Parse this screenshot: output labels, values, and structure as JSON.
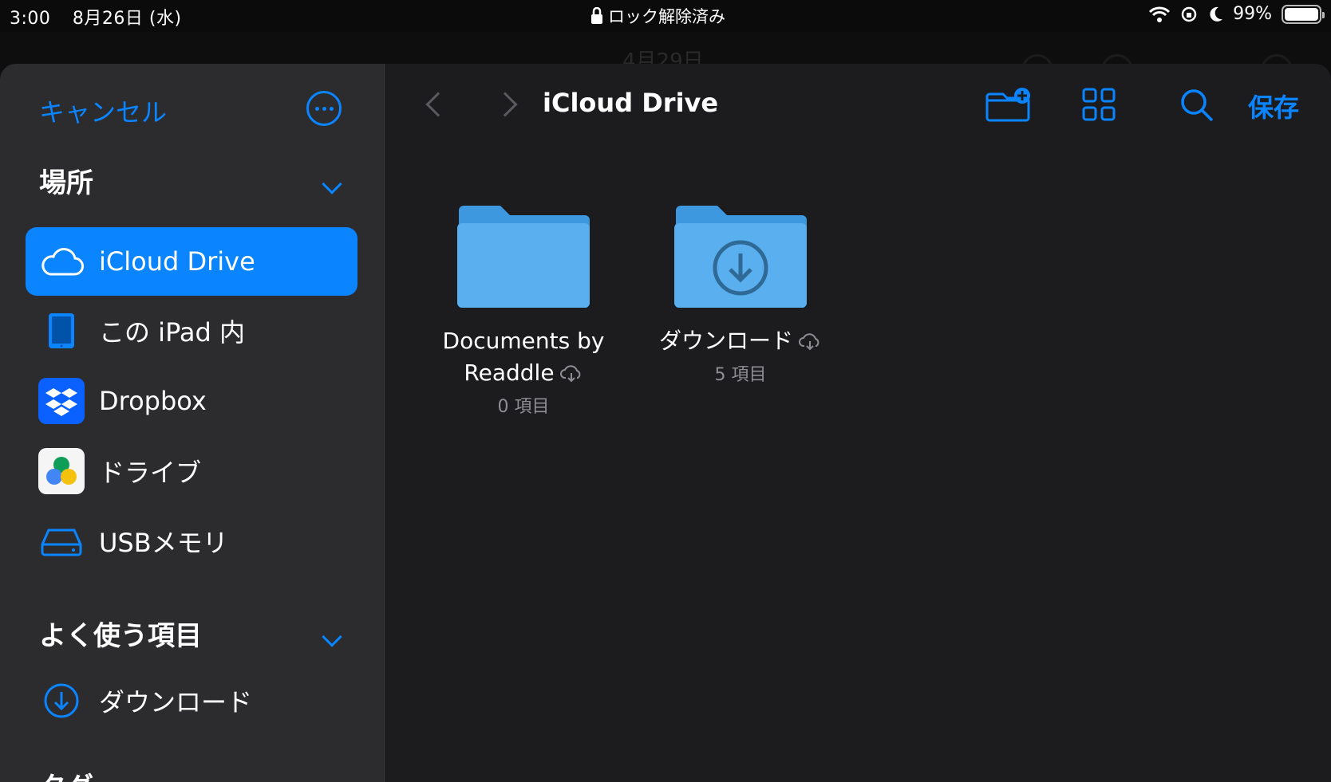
{
  "status": {
    "time": "3:00",
    "date": "8月26日 (水)",
    "lock_text": "ロック解除済み",
    "battery": "99%"
  },
  "background_app": {
    "title": "4月29日"
  },
  "sidebar": {
    "cancel_label": "キャンセル",
    "locations_title": "場所",
    "locations": [
      {
        "label": "iCloud Drive",
        "icon": "cloud-icon",
        "active": true
      },
      {
        "label": "この iPad 内",
        "icon": "ipad-icon",
        "active": false
      },
      {
        "label": "Dropbox",
        "icon": "dropbox-icon",
        "active": false
      },
      {
        "label": "ドライブ",
        "icon": "google-drive-icon",
        "active": false
      },
      {
        "label": "USBメモリ",
        "icon": "usb-drive-icon",
        "active": false
      }
    ],
    "favorites_title": "よく使う項目",
    "favorites": [
      {
        "label": "ダウンロード",
        "icon": "download-circle-icon"
      }
    ],
    "tags_title": "タグ"
  },
  "toolbar": {
    "title": "iCloud Drive",
    "save_label": "保存"
  },
  "folders": [
    {
      "name_line1": "Documents by",
      "name_line2": "Readdle",
      "count": "0 項目"
    },
    {
      "name_line1": "ダウンロード",
      "count": "5 項目"
    }
  ],
  "colors": {
    "accent": "#0a84ff",
    "sidebar_bg": "#2c2c2e",
    "main_bg": "#1c1c1e",
    "folder_blue": "#5ab0ee"
  }
}
